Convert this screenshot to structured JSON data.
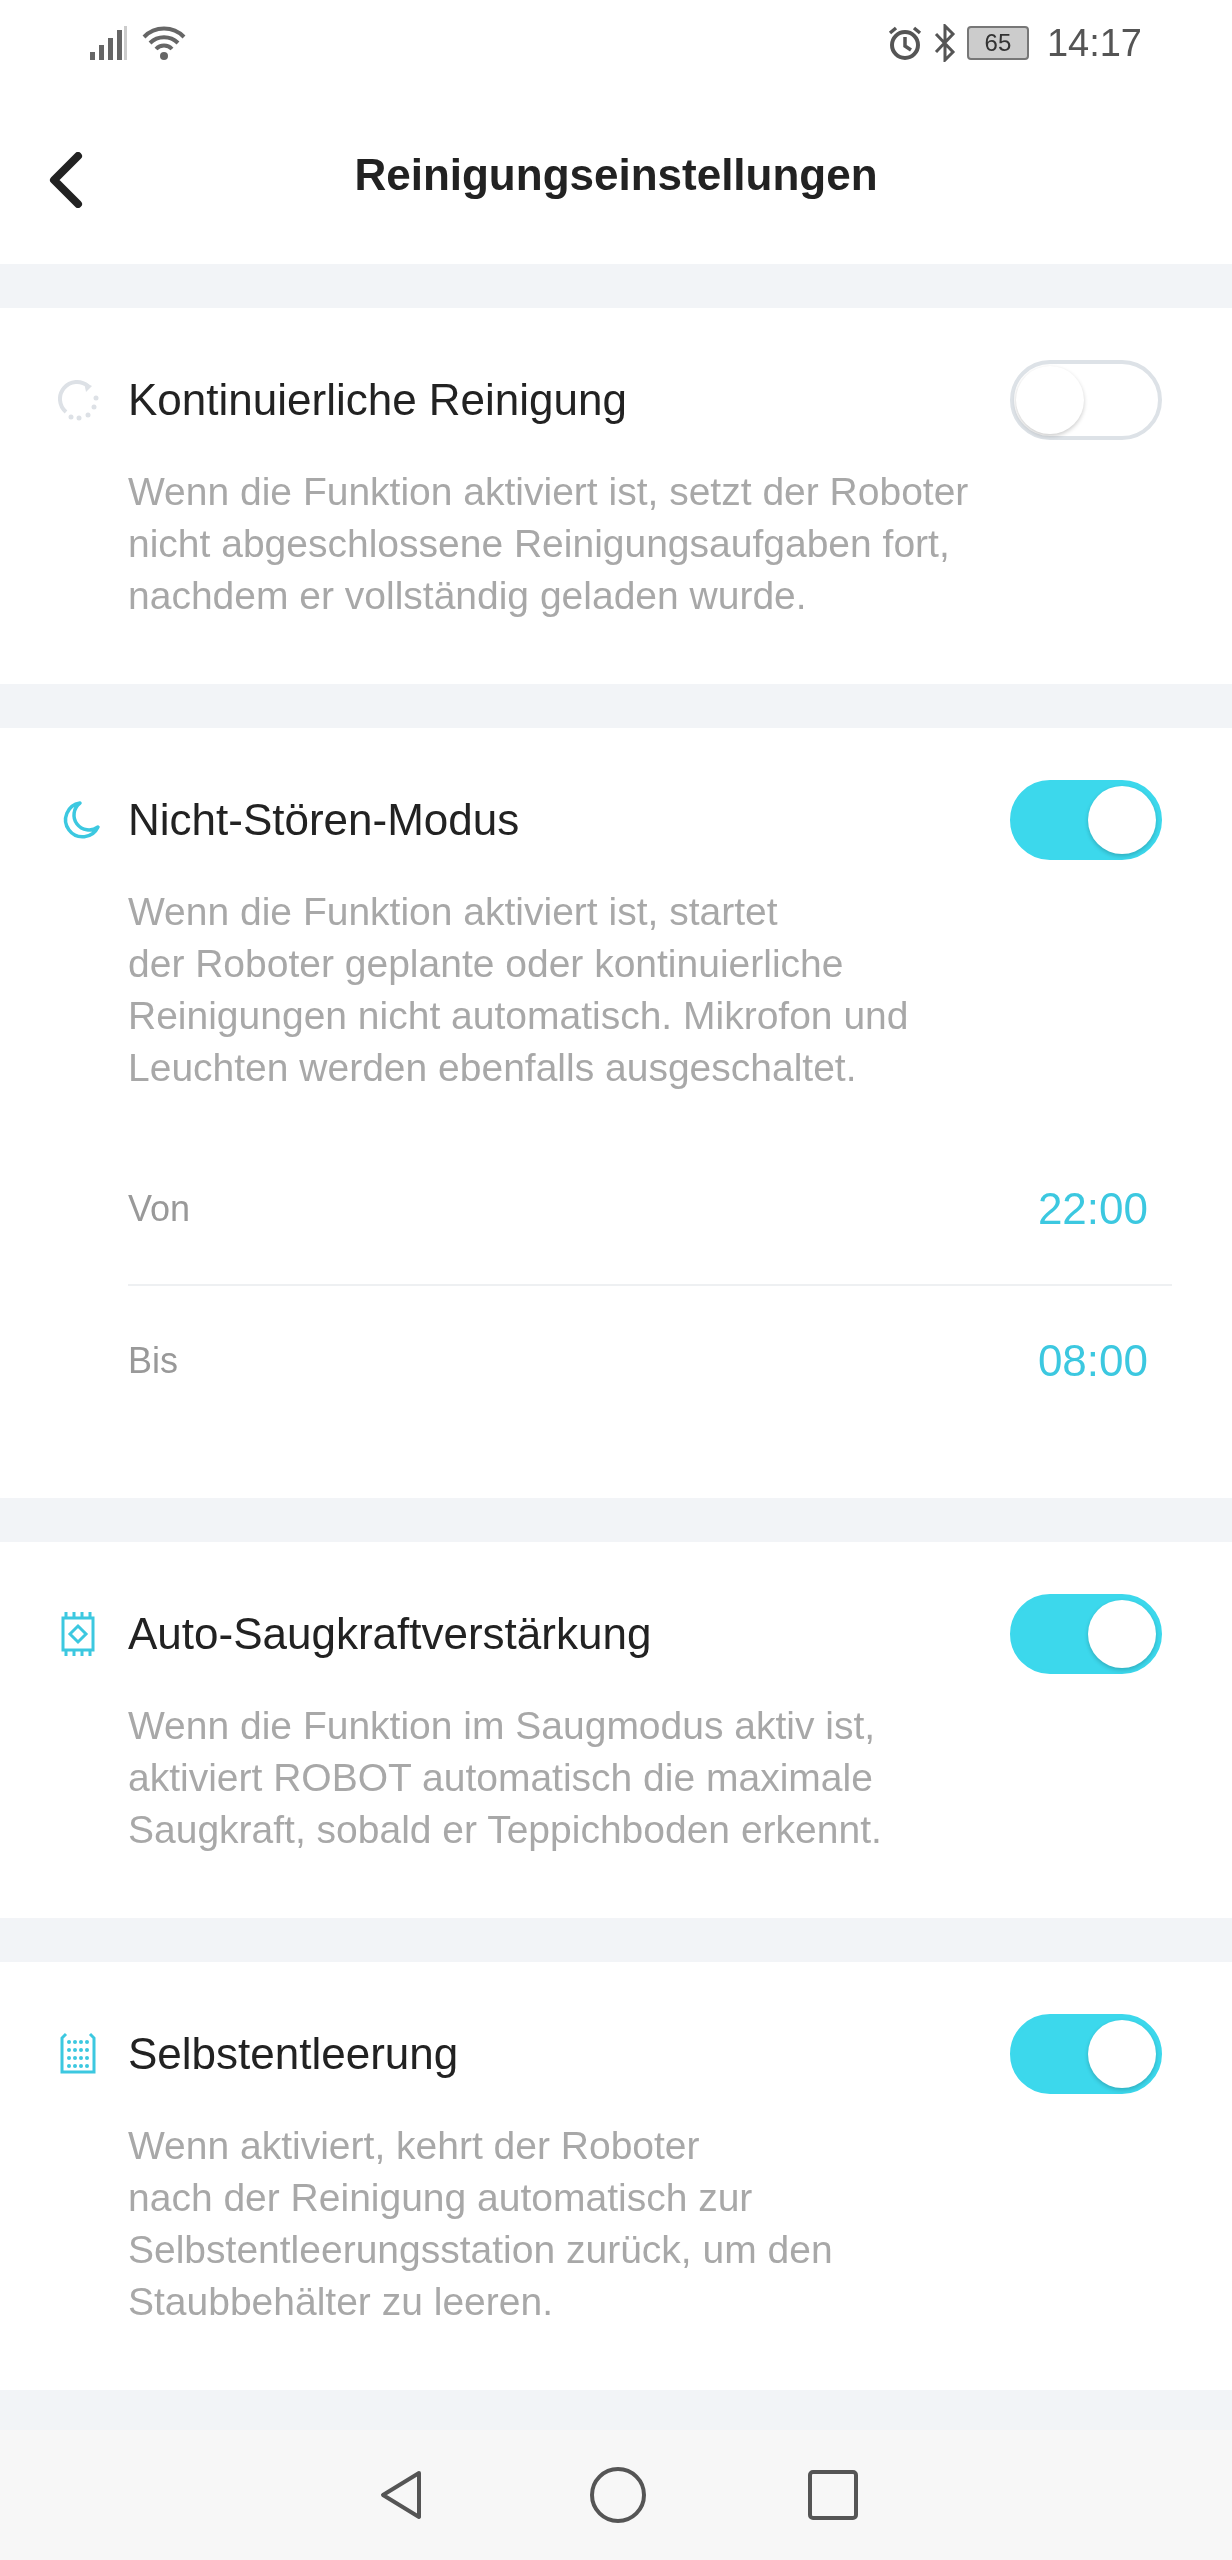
{
  "status_bar": {
    "battery": "65",
    "time": "14:17"
  },
  "header": {
    "title": "Reinigungseinstellungen"
  },
  "settings": [
    {
      "kind": "resume",
      "title": "Kontinuierliche Reinigung",
      "on": false,
      "description": [
        "Wenn die Funktion aktiviert ist, setzt der Roboter",
        "nicht abgeschlossene Reinigungsaufgaben fort,",
        "nachdem er vollständig geladen wurde."
      ]
    },
    {
      "kind": "moon",
      "title": "Nicht-Stören-Modus",
      "on": true,
      "description": [
        "Wenn die Funktion aktiviert ist, startet",
        "der Roboter geplante oder kontinuierliche",
        "Reinigungen nicht automatisch. Mikrofon und",
        "Leuchten werden ebenfalls ausgeschaltet."
      ],
      "times": [
        {
          "label": "Von",
          "value": "22:00"
        },
        {
          "label": "Bis",
          "value": "08:00"
        }
      ]
    },
    {
      "kind": "carpet",
      "title": "Auto-Saugkraftverstärkung",
      "on": true,
      "description": [
        "Wenn die Funktion im Saugmodus aktiv ist,",
        "aktiviert ROBOT automatisch die maximale",
        "Saugkraft, sobald er Teppichboden erkennt."
      ]
    },
    {
      "kind": "bin",
      "title": "Selbstentleerung",
      "on": true,
      "description": [
        "Wenn aktiviert, kehrt der Roboter",
        "nach der Reinigung automatisch zur",
        "Selbstentleerungsstation zurück, um den",
        "Staubbehälter zu leeren."
      ]
    }
  ]
}
